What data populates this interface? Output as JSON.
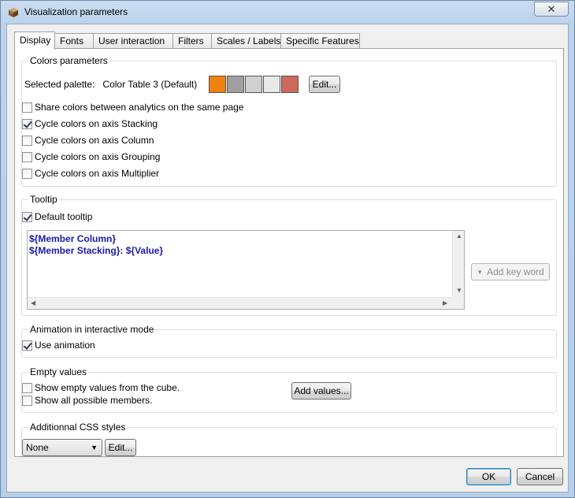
{
  "window": {
    "title": "Visualization parameters",
    "close_glyph": "✕"
  },
  "tabs": [
    {
      "label": "Display",
      "active": true
    },
    {
      "label": "Fonts",
      "active": false
    },
    {
      "label": "User interaction",
      "active": false
    },
    {
      "label": "Filters",
      "active": false
    },
    {
      "label": "Scales / Labels",
      "active": false
    },
    {
      "label": "Specific Features",
      "active": false
    }
  ],
  "colors": {
    "group_label": "Colors parameters",
    "selected_palette_label": "Selected palette:",
    "palette_name": "Color Table 3 (Default)",
    "swatches": [
      "#f08010",
      "#a0a0a0",
      "#d0d0d0",
      "#e8e8e8",
      "#cd6a5a"
    ],
    "edit_label": "Edit...",
    "checkboxes": [
      {
        "label": "Share colors between analytics on the same page",
        "checked": false
      },
      {
        "label": "Cycle colors on axis Stacking",
        "checked": true
      },
      {
        "label": "Cycle colors on axis Column",
        "checked": false
      },
      {
        "label": "Cycle colors on axis Grouping",
        "checked": false
      },
      {
        "label": "Cycle colors on axis Multiplier",
        "checked": false
      }
    ]
  },
  "tooltip": {
    "group_label": "Tooltip",
    "default_label": "Default tooltip",
    "default_checked": true,
    "line1": "${Member Column}",
    "line2_key": "${Member Stacking}",
    "line2_sep": ": ",
    "line2_val": "${Value}",
    "add_keyword_label": "Add key word"
  },
  "animation": {
    "group_label": "Animation in interactive mode",
    "use_label": "Use animation",
    "checked": true
  },
  "empty": {
    "group_label": "Empty values",
    "show_empty_label": "Show empty values from the cube.",
    "show_all_label": "Show all possible members.",
    "add_values_label": "Add values..."
  },
  "css": {
    "group_label": "Additionnal CSS styles",
    "selected": "None",
    "edit_label": "Edit..."
  },
  "footer": {
    "ok_label": "OK",
    "cancel_label": "Cancel"
  }
}
